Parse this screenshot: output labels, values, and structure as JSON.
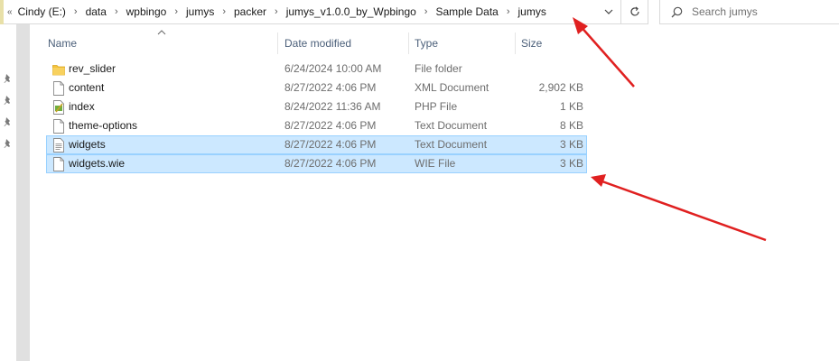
{
  "breadcrumb": {
    "items": [
      "Cindy (E:)",
      "data",
      "wpbingo",
      "jumys",
      "packer",
      "jumys_v1.0.0_by_Wpbingo",
      "Sample Data",
      "jumys"
    ]
  },
  "search": {
    "placeholder": "Search jumys"
  },
  "columns": {
    "name": "Name",
    "date": "Date modified",
    "type": "Type",
    "size": "Size"
  },
  "files": [
    {
      "name": "rev_slider",
      "date": "6/24/2024 10:00 AM",
      "type": "File folder",
      "size": "",
      "icon": "folder-icon",
      "selected": false
    },
    {
      "name": "content",
      "date": "8/27/2022 4:06 PM",
      "type": "XML Document",
      "size": "2,902 KB",
      "icon": "document-icon",
      "selected": false
    },
    {
      "name": "index",
      "date": "8/24/2022 11:36 AM",
      "type": "PHP File",
      "size": "1 KB",
      "icon": "php-file-icon",
      "selected": false
    },
    {
      "name": "theme-options",
      "date": "8/27/2022 4:06 PM",
      "type": "Text Document",
      "size": "8 KB",
      "icon": "document-icon",
      "selected": false
    },
    {
      "name": "widgets",
      "date": "8/27/2022 4:06 PM",
      "type": "Text Document",
      "size": "3 KB",
      "icon": "text-file-icon",
      "selected": true
    },
    {
      "name": "widgets.wie",
      "date": "8/27/2022 4:06 PM",
      "type": "WIE File",
      "size": "3 KB",
      "icon": "document-icon",
      "selected": true
    }
  ],
  "colors": {
    "selection_bg": "#cce8ff",
    "selection_border": "#99d1ff",
    "arrow": "#e02020",
    "header_text": "#4c607a",
    "folder": "#f5c33b"
  }
}
